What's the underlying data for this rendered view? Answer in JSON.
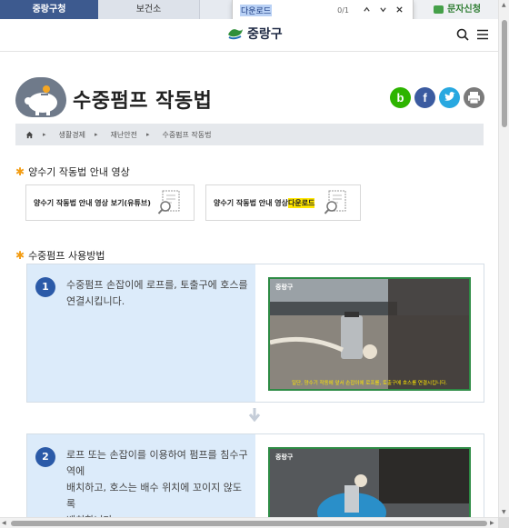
{
  "topbar": {
    "tabs": [
      "중랑구청",
      "보건소",
      ""
    ],
    "sms_label": "문자신청"
  },
  "findbar": {
    "query": "다운로드",
    "count": "0/1"
  },
  "header": {
    "logo_text": "중랑구"
  },
  "page": {
    "title": "수중펌프 작동법"
  },
  "share": {
    "blog": "b",
    "facebook": "f",
    "twitter": "t",
    "print": "⎙"
  },
  "breadcrumb": {
    "items": [
      "생활경제",
      "재난안전",
      "수중펌프 작동법"
    ]
  },
  "section_video": {
    "heading": "양수기 작동법 안내 영상",
    "btn_youtube": "양수기 작동법 안내 영상 보기(유튜브)",
    "btn_download_prefix": "양수기 작동법 안내 영상 ",
    "btn_download_highlight": "다운로드"
  },
  "section_usage": {
    "heading": "수중펌프 사용방법",
    "steps": [
      {
        "num": "1",
        "desc_line1": "수중펌프 손잡이에 로프를, 토출구에 호스를",
        "desc_line2": "연결시킵니다.",
        "photo_logo": "중랑구",
        "photo_caption": "일단, 양수기 작동에 앞서 손잡이에 로프를, 토출구에 호스를 연결시킵니다."
      },
      {
        "num": "2",
        "desc_line1": "로프 또는 손잡이를 이용하여 펌프를 침수구역에",
        "desc_line2": "배치하고, 호스는 배수 위치에 꼬이지 않도록",
        "desc_line3": "배치합니다.",
        "photo_logo": "중랑구"
      }
    ]
  },
  "colors": {
    "tab_active": "#3d5a8f",
    "breadcrumb_bg": "#e5e8ec",
    "step_bg": "#dcebfa",
    "step_num": "#2b5aa8",
    "photo_border": "#2e8b45",
    "star": "#f39c12",
    "highlight": "#ffe600"
  }
}
